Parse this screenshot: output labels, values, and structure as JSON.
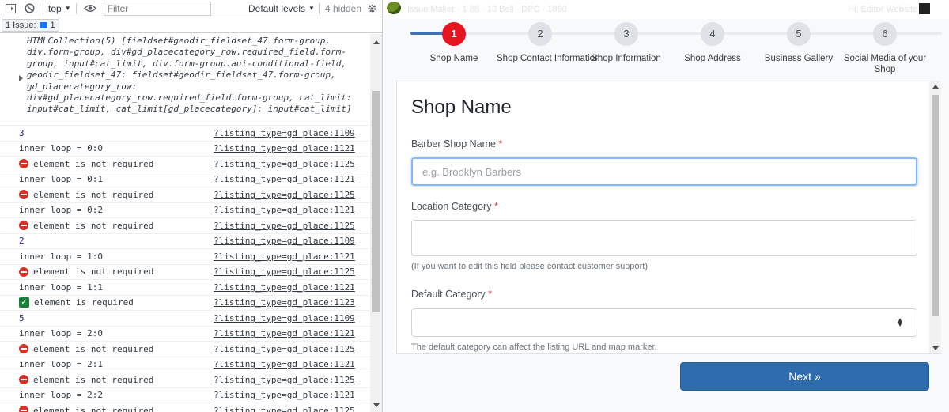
{
  "devtools": {
    "toolbar": {
      "context": "top",
      "filter_placeholder": "Filter",
      "levels": "Default levels",
      "hidden": "4 hidden"
    },
    "issues": {
      "label": "1 Issue:",
      "count": "1"
    },
    "collection_text": "HTMLCollection(5) [fieldset#geodir_fieldset_47.form-group, div.form-group, div#gd_placecategory_row.required_field.form-group, input#cat_limit, div.form-group.aui-conditional-field, geodir_fieldset_47: fieldset#geodir_fieldset_47.form-group, gd_placecategory_row: div#gd_placecategory_row.required_field.form-group, cat_limit: input#cat_limit, cat_limit[gd_placecategory]: input#cat_limit]",
    "rows": [
      {
        "msg": "3",
        "src": "?listing_type=gd_place:1109",
        "kind": "num"
      },
      {
        "msg": "inner loop = 0:0",
        "src": "?listing_type=gd_place:1121",
        "kind": "log"
      },
      {
        "msg": "element is not required",
        "src": "?listing_type=gd_place:1125",
        "kind": "error"
      },
      {
        "msg": "inner loop = 0:1",
        "src": "?listing_type=gd_place:1121",
        "kind": "log"
      },
      {
        "msg": "element is not required",
        "src": "?listing_type=gd_place:1125",
        "kind": "error"
      },
      {
        "msg": "inner loop = 0:2",
        "src": "?listing_type=gd_place:1121",
        "kind": "log"
      },
      {
        "msg": "element is not required",
        "src": "?listing_type=gd_place:1125",
        "kind": "error"
      },
      {
        "msg": "2",
        "src": "?listing_type=gd_place:1109",
        "kind": "num"
      },
      {
        "msg": "inner loop = 1:0",
        "src": "?listing_type=gd_place:1121",
        "kind": "log"
      },
      {
        "msg": "element is not required",
        "src": "?listing_type=gd_place:1125",
        "kind": "error"
      },
      {
        "msg": "inner loop = 1:1",
        "src": "?listing_type=gd_place:1121",
        "kind": "log"
      },
      {
        "msg": "element is required",
        "src": "?listing_type=gd_place:1123",
        "kind": "success"
      },
      {
        "msg": "5",
        "src": "?listing_type=gd_place:1109",
        "kind": "num"
      },
      {
        "msg": "inner loop = 2:0",
        "src": "?listing_type=gd_place:1121",
        "kind": "log"
      },
      {
        "msg": "element is not required",
        "src": "?listing_type=gd_place:1125",
        "kind": "error"
      },
      {
        "msg": "inner loop = 2:1",
        "src": "?listing_type=gd_place:1121",
        "kind": "log"
      },
      {
        "msg": "element is not required",
        "src": "?listing_type=gd_place:1125",
        "kind": "error"
      },
      {
        "msg": "inner loop = 2:2",
        "src": "?listing_type=gd_place:1121",
        "kind": "log"
      },
      {
        "msg": "element is not required",
        "src": "?listing_type=gd_place:1125",
        "kind": "error"
      }
    ]
  },
  "page": {
    "adminbar": {
      "site": "Issue Maker · 1 88 · 10 Bell · DPC · 1890",
      "greeting": "Hi, Editor Website"
    },
    "steps": [
      {
        "num": "1",
        "label": "Shop Name",
        "active": true
      },
      {
        "num": "2",
        "label": "Shop Contact Information",
        "active": false
      },
      {
        "num": "3",
        "label": "Shop Information",
        "active": false
      },
      {
        "num": "4",
        "label": "Shop Address",
        "active": false
      },
      {
        "num": "5",
        "label": "Business Gallery",
        "active": false
      },
      {
        "num": "6",
        "label": "Social Media of your Shop",
        "active": false
      }
    ],
    "form": {
      "title": "Shop Name",
      "barber_label": "Barber Shop Name",
      "barber_placeholder": "e.g. Brooklyn Barbers",
      "location_label": "Location Category",
      "location_help": "(If you want to edit this field please contact customer support)",
      "default_label": "Default Category",
      "default_help": "The default category can affect the listing URL and map marker.",
      "required_mark": "*"
    },
    "next_label": "Next »"
  },
  "colors": {
    "active_step": "#e5141e",
    "progress": "#3e72b0",
    "next_button": "#2f6cae",
    "required": "#dc3545",
    "error_icon": "#d93025",
    "success_icon": "#188038"
  }
}
